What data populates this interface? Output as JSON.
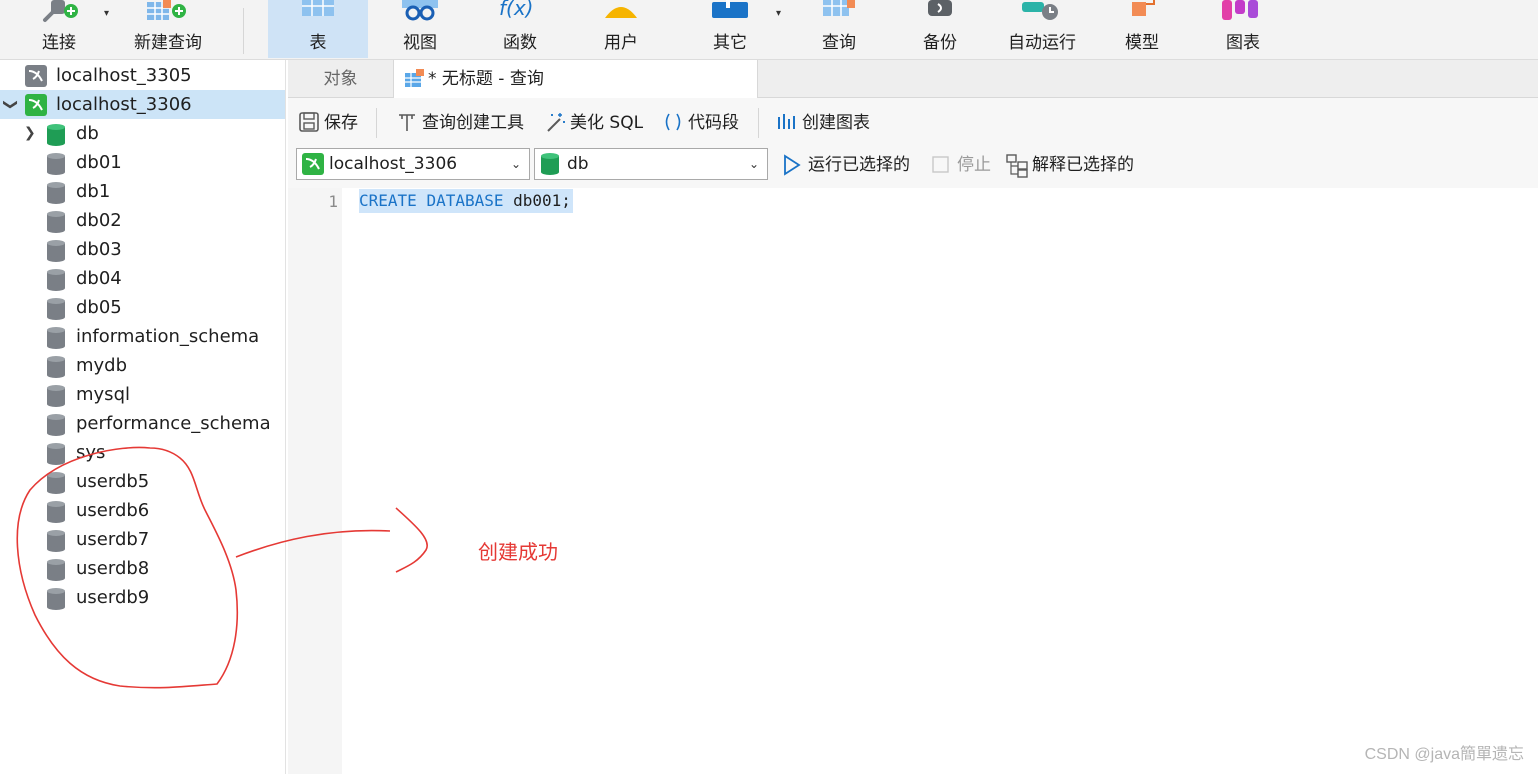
{
  "toolbar": {
    "items": [
      {
        "label": "连接",
        "icon": "plug-icon"
      },
      {
        "label": "新建查询",
        "icon": "new-query-icon"
      },
      {
        "label": "表",
        "icon": "table-icon"
      },
      {
        "label": "视图",
        "icon": "view-icon"
      },
      {
        "label": "函数",
        "icon": "function-icon"
      },
      {
        "label": "用户",
        "icon": "user-icon"
      },
      {
        "label": "其它",
        "icon": "other-icon"
      },
      {
        "label": "查询",
        "icon": "query-icon"
      },
      {
        "label": "备份",
        "icon": "backup-icon"
      },
      {
        "label": "自动运行",
        "icon": "automation-icon"
      },
      {
        "label": "模型",
        "icon": "model-icon"
      },
      {
        "label": "图表",
        "icon": "chart-icon"
      }
    ],
    "active": "表",
    "dropdown_glyph": "▾"
  },
  "sidebar": {
    "connections": [
      {
        "name": "localhost_3305",
        "expanded": false
      },
      {
        "name": "localhost_3306",
        "expanded": true,
        "selected": true
      }
    ],
    "databases": [
      {
        "name": "db",
        "active": true
      },
      {
        "name": "db01"
      },
      {
        "name": "db1"
      },
      {
        "name": "db02"
      },
      {
        "name": "db03"
      },
      {
        "name": "db04"
      },
      {
        "name": "db05"
      },
      {
        "name": "information_schema"
      },
      {
        "name": "mydb"
      },
      {
        "name": "mysql"
      },
      {
        "name": "performance_schema"
      },
      {
        "name": "sys"
      },
      {
        "name": "userdb5"
      },
      {
        "name": "userdb6"
      },
      {
        "name": "userdb7"
      },
      {
        "name": "userdb8"
      },
      {
        "name": "userdb9"
      }
    ],
    "expand_glyph": "❯",
    "collapse_glyph": "❯"
  },
  "tabs": {
    "objects": "对象",
    "query": "* 无标题 - 查询"
  },
  "query_toolbar": {
    "save": "保存",
    "query_builder": "查询创建工具",
    "beautify": "美化 SQL",
    "snippet": "代码段",
    "create_chart": "创建图表"
  },
  "selectors": {
    "connection": "localhost_3306",
    "database": "db",
    "caret": "⌄",
    "run_selected": "运行已选择的",
    "stop": "停止",
    "explain_selected": "解释已选择的"
  },
  "editor": {
    "line_number": "1",
    "kw1": "CREATE",
    "kw2": "DATABASE",
    "rest": "db001;"
  },
  "annotation": {
    "text": "创建成功",
    "color": "#e53935"
  },
  "watermark": "CSDN @java簡單遗忘",
  "colors": {
    "accent": "#cfe3f6",
    "selection": "#cce4f7",
    "keyword": "#1a73c7",
    "db_active": "#1f9d55",
    "db_inactive": "#7a7f86"
  }
}
